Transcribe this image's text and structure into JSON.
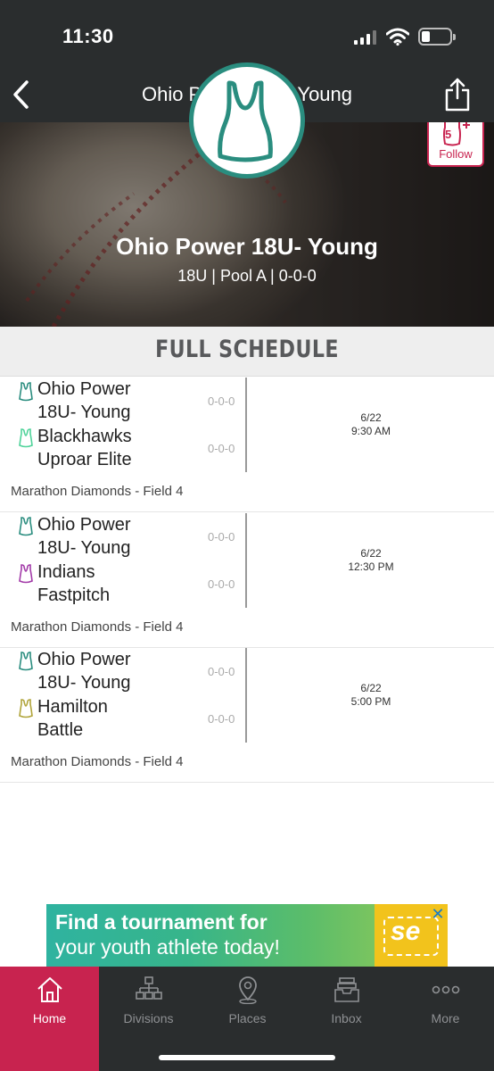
{
  "status_bar": {
    "time": "11:30"
  },
  "nav": {
    "title": "Ohio Power 18U- Young"
  },
  "hero": {
    "team_name": "Ohio Power 18U- Young",
    "subtitle": "18U | Pool A | 0-0-0",
    "follow_label": "Follow",
    "follow_badge": "5"
  },
  "schedule": {
    "header": "FULL SCHEDULE",
    "games": [
      {
        "home": {
          "line1": "Ohio Power",
          "line2": "18U- Young",
          "record": "0-0-0",
          "color": "#2a8d7f"
        },
        "away": {
          "line1": "Blackhawks",
          "line2": "Uproar Elite",
          "record": "0-0-0",
          "color": "#4fd39a"
        },
        "date": "6/22",
        "time": "9:30 AM",
        "venue": "Marathon Diamonds - Field 4"
      },
      {
        "home": {
          "line1": "Ohio Power",
          "line2": "18U- Young",
          "record": "0-0-0",
          "color": "#2a8d7f"
        },
        "away": {
          "line1": "Indians",
          "line2": "Fastpitch",
          "record": "0-0-0",
          "color": "#a23aa8"
        },
        "date": "6/22",
        "time": "12:30 PM",
        "venue": "Marathon Diamonds - Field 4"
      },
      {
        "home": {
          "line1": "Ohio Power",
          "line2": "18U- Young",
          "record": "0-0-0",
          "color": "#2a8d7f"
        },
        "away": {
          "line1": "Hamilton",
          "line2": "Battle",
          "record": "0-0-0",
          "color": "#b0a43a"
        },
        "date": "6/22",
        "time": "5:00 PM",
        "venue": "Marathon Diamonds - Field 4"
      }
    ]
  },
  "ad": {
    "line1": "Find a tournament for",
    "line2": "your youth athlete today!",
    "logo_text": "se"
  },
  "tabs": [
    {
      "label": "Home",
      "icon": "home-icon",
      "active": true
    },
    {
      "label": "Divisions",
      "icon": "divisions-icon",
      "active": false
    },
    {
      "label": "Places",
      "icon": "places-icon",
      "active": false
    },
    {
      "label": "Inbox",
      "icon": "inbox-icon",
      "active": false
    },
    {
      "label": "More",
      "icon": "more-icon",
      "active": false
    }
  ],
  "colors": {
    "accent": "#c8234f",
    "team": "#2a8d7f",
    "bar": "#2a2d2e"
  }
}
